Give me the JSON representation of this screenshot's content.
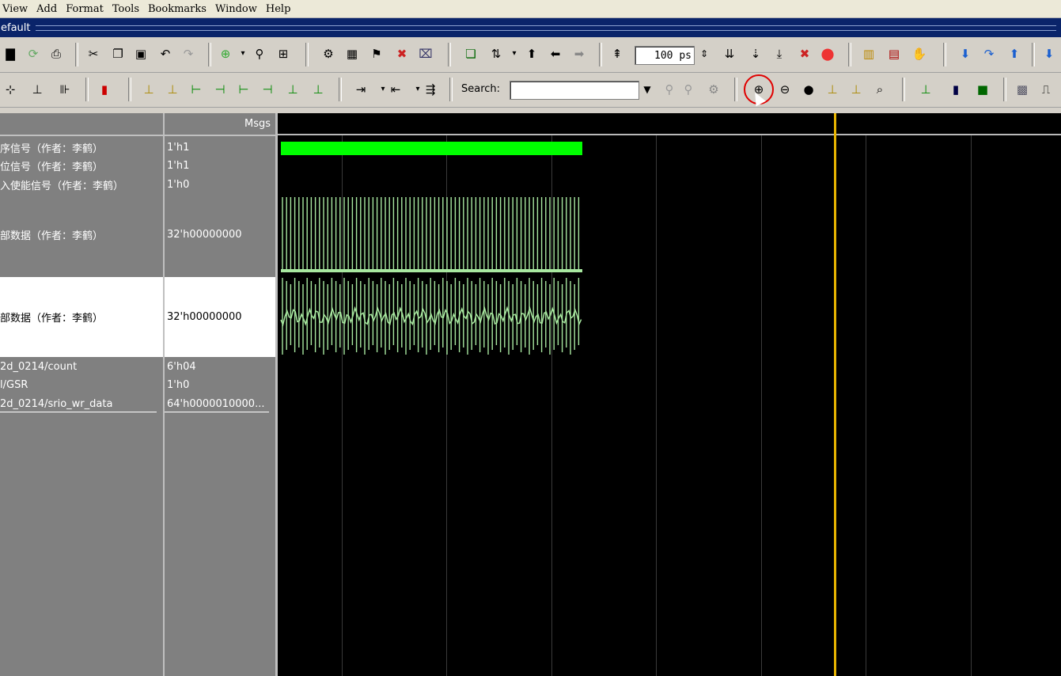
{
  "menu": [
    "View",
    "Add",
    "Format",
    "Tools",
    "Bookmarks",
    "Window",
    "Help"
  ],
  "window": {
    "title": "efault"
  },
  "toolbar1": {
    "time_value": "100 ps"
  },
  "toolbar2": {
    "search_label": "Search:",
    "search_value": ""
  },
  "columns": {
    "msgs_header": "Msgs"
  },
  "signals": [
    {
      "name": "序信号（作者：李鹤）",
      "value": "1'h1"
    },
    {
      "name": "位信号（作者：李鹤）",
      "value": "1'h1"
    },
    {
      "name": "入使能信号（作者：李鹤）",
      "value": "1'h0"
    },
    {
      "name": "部数据（作者：李鹤）",
      "value": "32'h00000000"
    },
    {
      "name": "部数据（作者：李鹤）",
      "value": "32'h00000000"
    },
    {
      "name": "2d_0214/count",
      "value": "6'h04"
    },
    {
      "name": "l/GSR",
      "value": "1'h0"
    },
    {
      "name": "2d_0214/srio_wr_data",
      "value": "64'h0000010000..."
    }
  ],
  "colors": {
    "background": "#000000",
    "wave_green": "#00ff00",
    "analog_wave": "#a8e8a0",
    "cursor": "#e8b400",
    "highlight": "#e00000"
  }
}
